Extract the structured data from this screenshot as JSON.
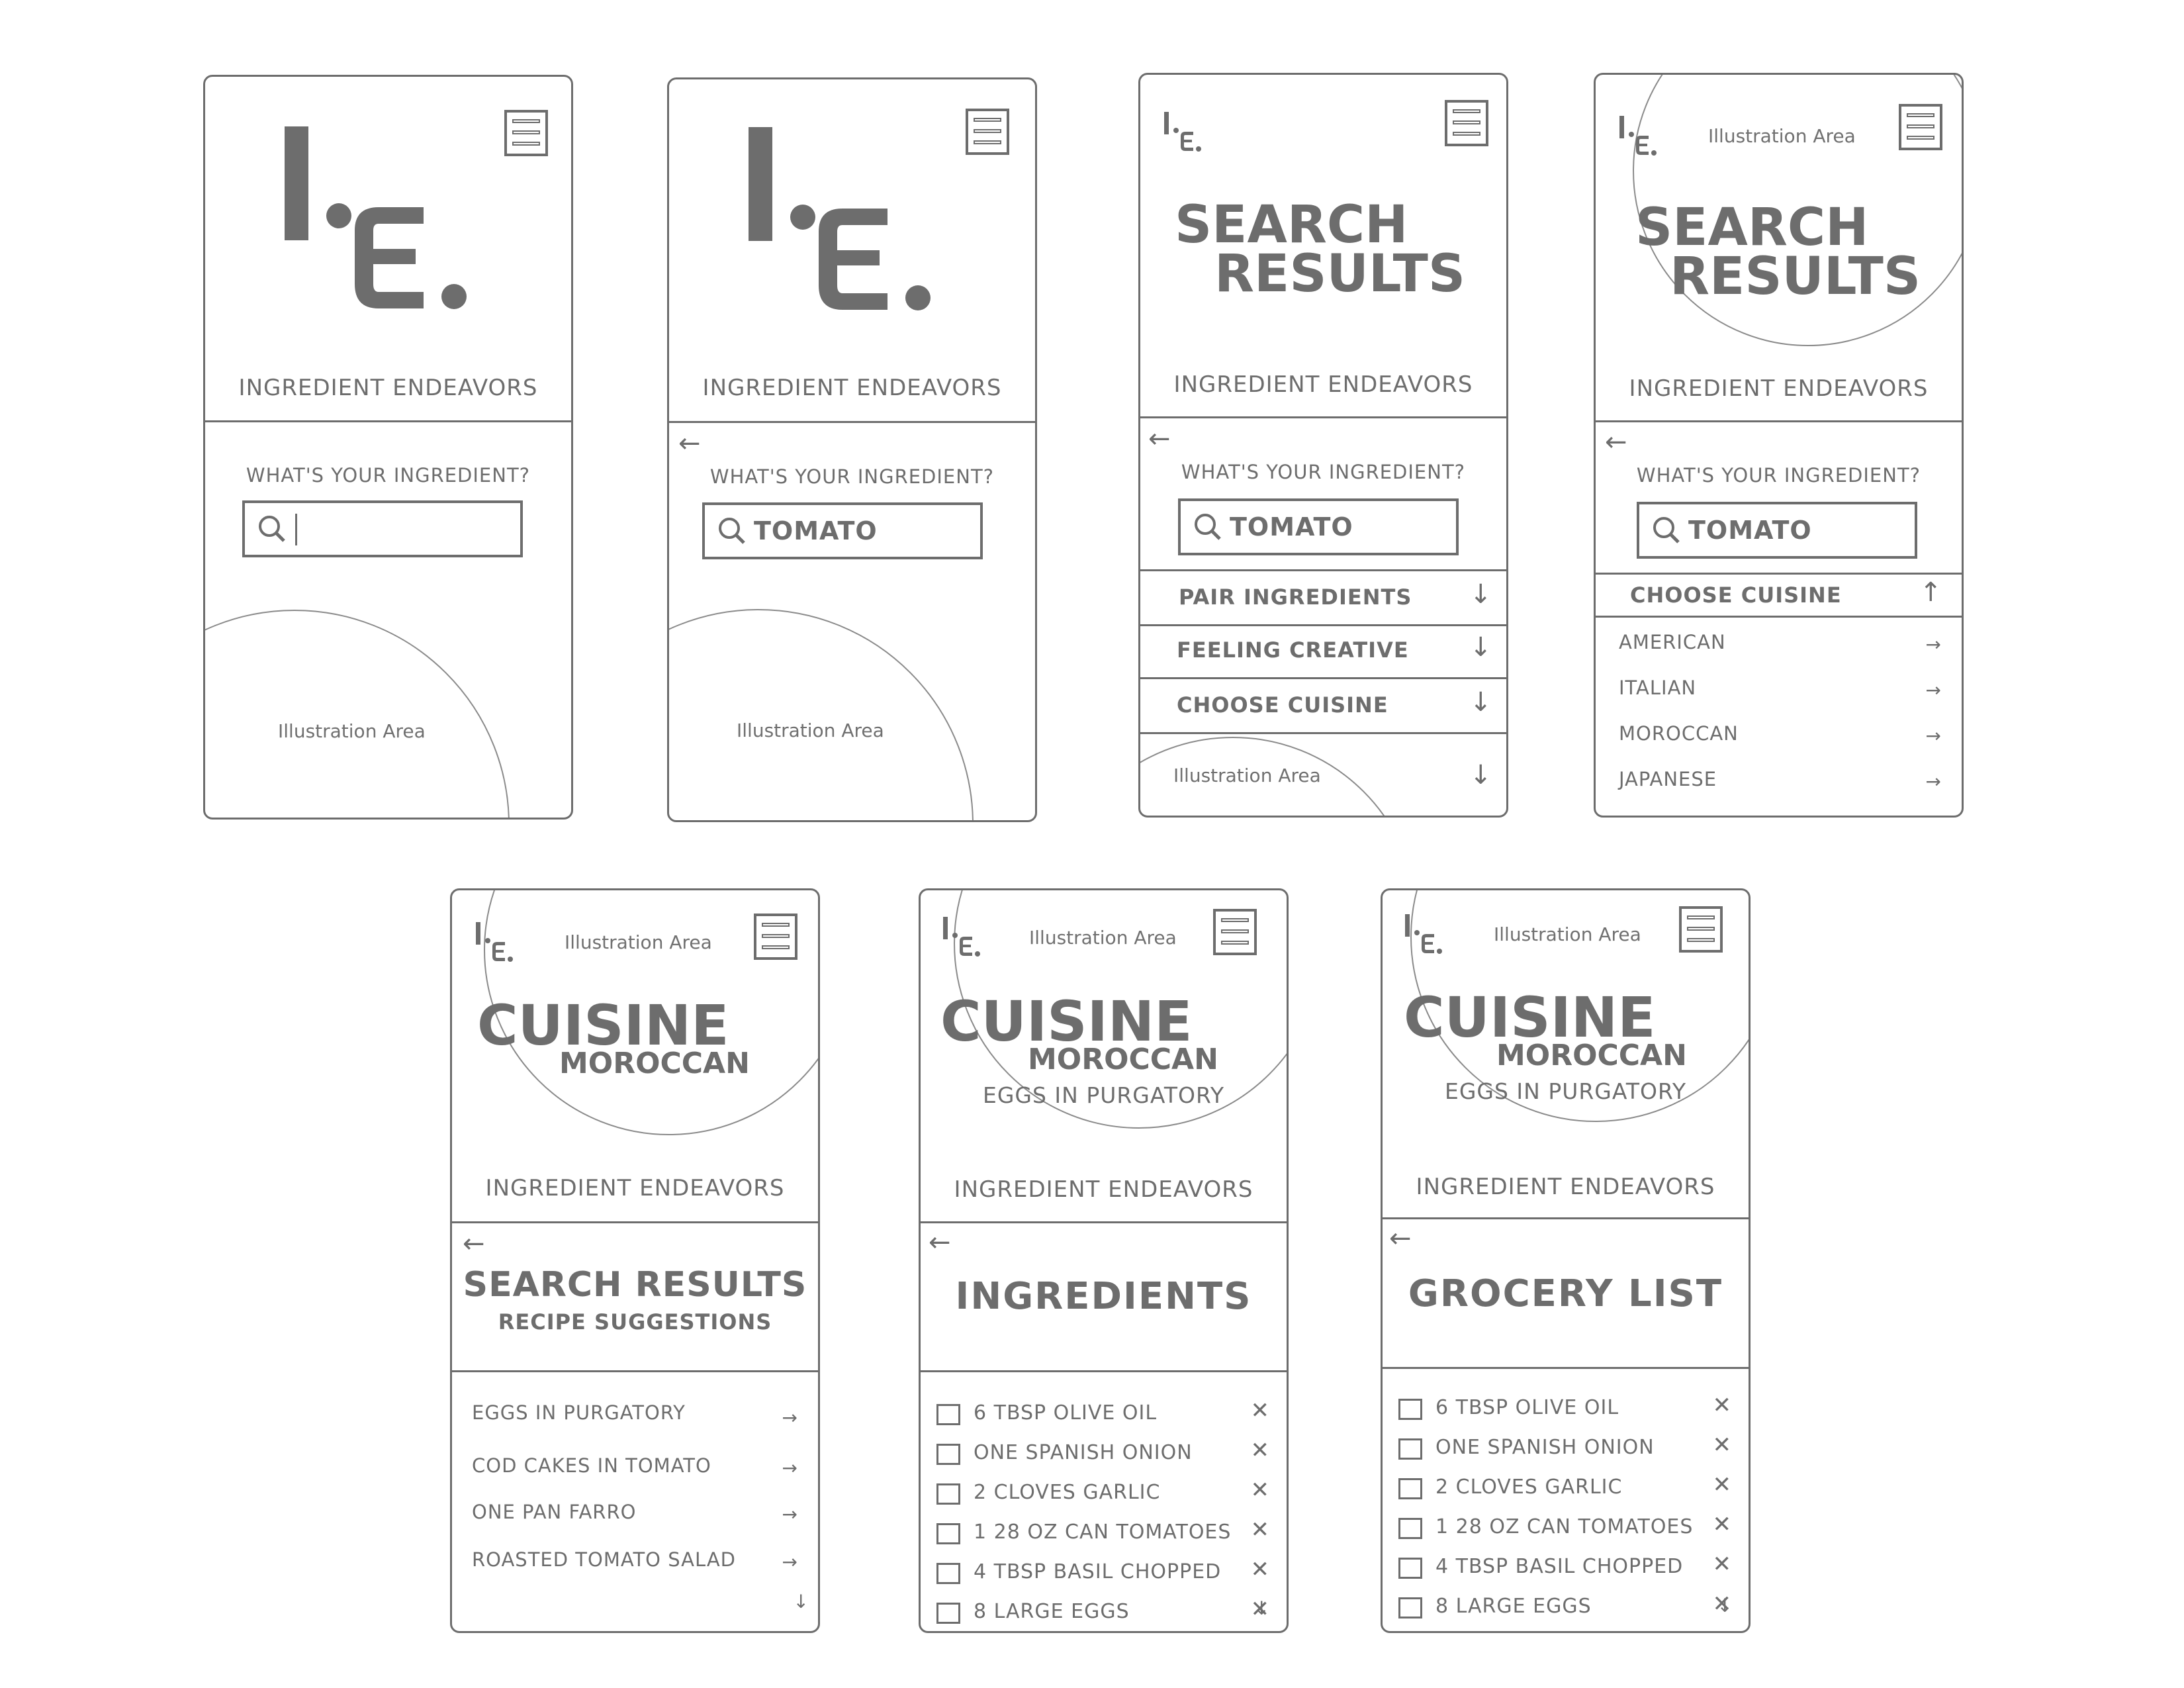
{
  "brand": {
    "logo_letters": [
      "I",
      "E"
    ],
    "name": "INGREDIENT ENDEAVORS",
    "illustration_label": "Illustration Area"
  },
  "colors": {
    "ink": "#6d6d6d",
    "background": "#ffffff"
  },
  "icons": {
    "menu": "hamburger-menu-icon",
    "search": "search-icon",
    "back": "←",
    "down": "↓",
    "up": "↑",
    "right": "→",
    "remove": "✕"
  },
  "screens": [
    {
      "id": "home-empty",
      "prompt": "WHAT'S YOUR INGREDIENT?",
      "search_value": ""
    },
    {
      "id": "home-filled",
      "prompt": "WHAT'S YOUR INGREDIENT?",
      "search_value": "TOMATO"
    },
    {
      "id": "search-results",
      "title_line1": "SEARCH",
      "title_line2": "RESULTS",
      "prompt": "WHAT'S YOUR INGREDIENT?",
      "search_value": "TOMATO",
      "accordions": [
        {
          "label": "PAIR INGREDIENTS",
          "state": "collapsed"
        },
        {
          "label": "FEELING CREATIVE",
          "state": "collapsed"
        },
        {
          "label": "CHOOSE CUISINE",
          "state": "collapsed"
        }
      ]
    },
    {
      "id": "choose-cuisine",
      "title_line1": "SEARCH",
      "title_line2": "RESULTS",
      "prompt": "WHAT'S YOUR INGREDIENT?",
      "search_value": "TOMATO",
      "accordion_label": "CHOOSE CUISINE",
      "accordion_state": "expanded",
      "options": [
        "AMERICAN",
        "ITALIAN",
        "MOROCCAN",
        "JAPANESE"
      ]
    },
    {
      "id": "recipe-suggestions",
      "title": "CUISINE",
      "subtitle": "MOROCCAN",
      "section_title": "SEARCH RESULTS",
      "section_subtitle": "RECIPE SUGGESTIONS",
      "recipes": [
        "EGGS IN PURGATORY",
        "COD CAKES IN TOMATO",
        "ONE PAN FARRO",
        "ROASTED TOMATO SALAD"
      ]
    },
    {
      "id": "ingredients",
      "title": "CUISINE",
      "subtitle": "MOROCCAN",
      "recipe": "EGGS IN PURGATORY",
      "section_title": "INGREDIENTS",
      "items": [
        "6 TBSP OLIVE OIL",
        "ONE SPANISH ONION",
        "2 CLOVES GARLIC",
        "1 28 OZ CAN TOMATOES",
        "4 TBSP BASIL CHOPPED",
        "8 LARGE EGGS"
      ]
    },
    {
      "id": "grocery-list",
      "title": "CUISINE",
      "subtitle": "MOROCCAN",
      "recipe": "EGGS IN PURGATORY",
      "section_title": "GROCERY LIST",
      "items": [
        "6 TBSP OLIVE OIL",
        "ONE SPANISH ONION",
        "2 CLOVES GARLIC",
        "1 28 OZ CAN TOMATOES",
        "4 TBSP BASIL CHOPPED",
        "8 LARGE EGGS"
      ]
    }
  ]
}
